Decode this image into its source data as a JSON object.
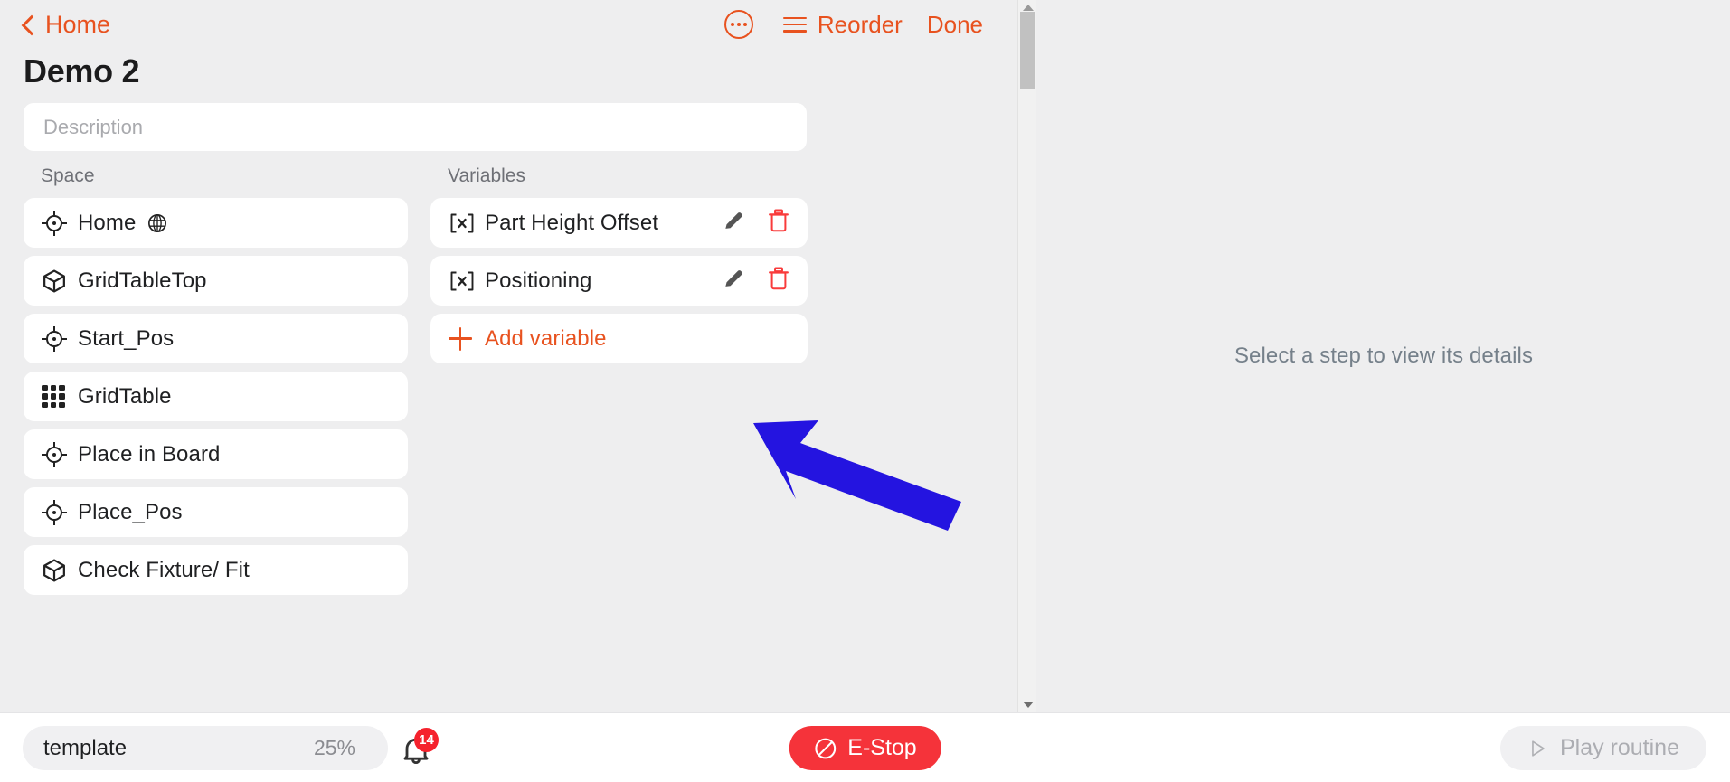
{
  "header": {
    "back_label": "Home",
    "back_icon": "chevron-left-icon",
    "more_icon": "more-options-icon",
    "reorder_label": "Reorder",
    "reorder_icon": "hamburger-icon",
    "done_label": "Done"
  },
  "routine": {
    "title": "Demo 2",
    "description_value": "",
    "description_placeholder": "Description"
  },
  "space": {
    "heading": "Space",
    "items": [
      {
        "label": "Home",
        "icon": "crosshair-icon",
        "badge_icon": "globe-icon"
      },
      {
        "label": "GridTableTop",
        "icon": "cube-icon",
        "badge_icon": ""
      },
      {
        "label": "Start_Pos",
        "icon": "crosshair-icon",
        "badge_icon": ""
      },
      {
        "label": "GridTable",
        "icon": "grid-icon",
        "badge_icon": ""
      },
      {
        "label": "Place in Board",
        "icon": "crosshair-icon",
        "badge_icon": ""
      },
      {
        "label": "Place_Pos",
        "icon": "crosshair-icon",
        "badge_icon": ""
      },
      {
        "label": "Check Fixture/ Fit",
        "icon": "cube-icon",
        "badge_icon": ""
      }
    ]
  },
  "variables": {
    "heading": "Variables",
    "items": [
      {
        "label": "Part Height Offset",
        "icon": "variable-icon",
        "edit_icon": "pencil-icon",
        "delete_icon": "trash-icon"
      },
      {
        "label": "Positioning",
        "icon": "variable-icon",
        "edit_icon": "pencil-icon",
        "delete_icon": "trash-icon"
      }
    ],
    "add_label": "Add variable",
    "add_icon": "plus-icon"
  },
  "details": {
    "empty_hint": "Select a step to view its details"
  },
  "statusbar": {
    "robot_name": "template",
    "battery": "25%",
    "bell_icon": "bell-icon",
    "bell_count": "14",
    "estop_label": "E-Stop",
    "estop_icon": "prohibition-icon",
    "play_label": "Play routine",
    "play_icon": "play-icon"
  },
  "annotation": {
    "arrow_color": "#2414e0",
    "arrow_points_to": "Add variable"
  },
  "colors": {
    "accent_orange": "#e8521f",
    "danger_red": "#f5333a",
    "trash_red": "#f93b3b",
    "page_bg": "#eeeeef",
    "card_bg": "#ffffff"
  },
  "scrollbar": {
    "up_icon": "triangle-up-icon",
    "down_icon": "triangle-down-icon"
  }
}
